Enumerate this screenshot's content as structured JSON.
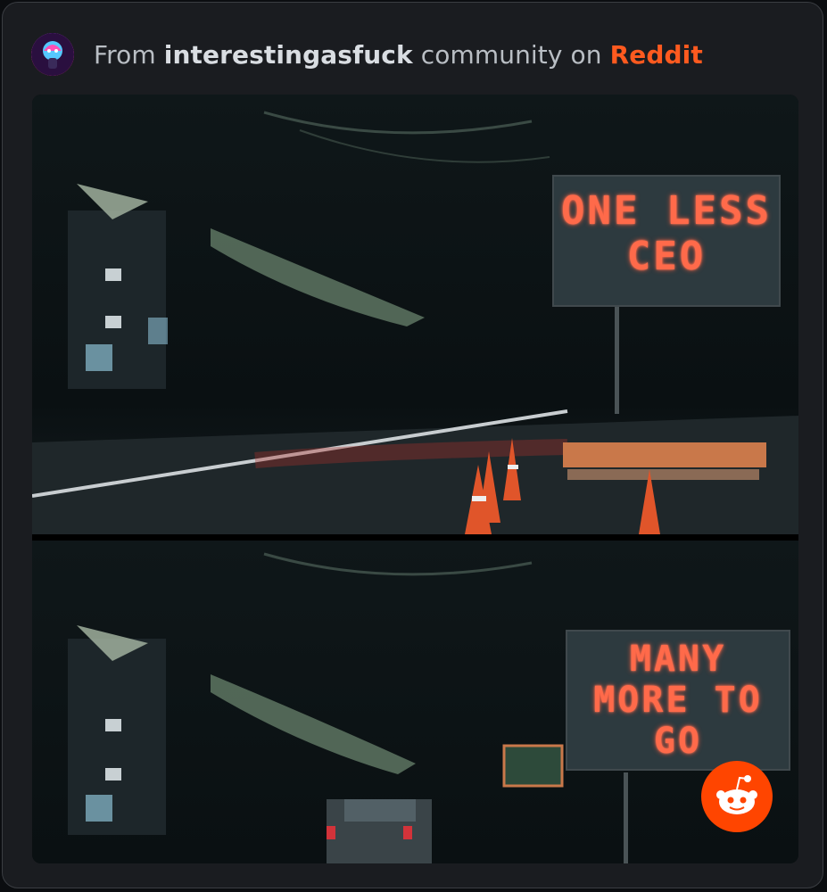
{
  "header": {
    "prefix": "From",
    "community": "interestingasfuck",
    "middle": "community on",
    "platform": "Reddit"
  },
  "media": {
    "top_panel": {
      "sign_lines": [
        "ONE LESS",
        "CEO"
      ]
    },
    "bottom_panel": {
      "sign_lines": [
        "MANY",
        "MORE TO",
        "GO"
      ]
    }
  },
  "icons": {
    "avatar": "community-avatar-icon",
    "badge": "reddit-logo-icon"
  },
  "colors": {
    "card_bg": "#1a1c20",
    "platform_accent": "#ff5a1f",
    "sign_text": "#ff6a4a",
    "reddit_orange": "#ff4500"
  }
}
